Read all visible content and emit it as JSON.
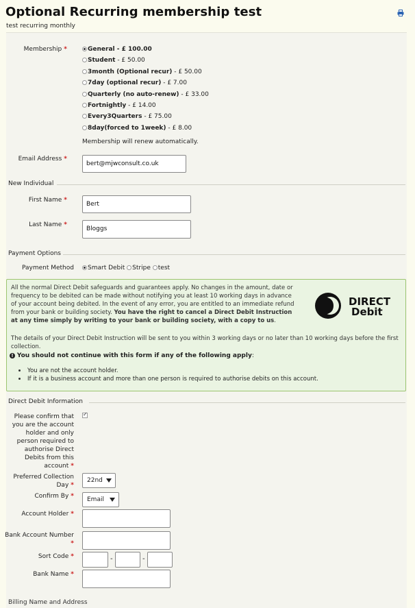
{
  "header": {
    "title": "Optional Recurring membership test",
    "subtitle": "test recurring monthly"
  },
  "membership": {
    "label": "Membership",
    "required": "*",
    "options": [
      {
        "name": "General",
        "price": " - £ 100.00"
      },
      {
        "name": "Student",
        "price": " - £ 50.00"
      },
      {
        "name": "3month (Optional recur)",
        "price": " - £ 50.00"
      },
      {
        "name": "7day (optional recur)",
        "price": " - £ 7.00"
      },
      {
        "name": "Quarterly (no auto-renew)",
        "price": " - £ 33.00"
      },
      {
        "name": "Fortnightly",
        "price": " - £ 14.00"
      },
      {
        "name": "Every3Quarters",
        "price": " - £ 75.00"
      },
      {
        "name": "8day(forced to 1week)",
        "price": " - £ 8.00"
      }
    ],
    "selected": "General",
    "renew_note": "Membership will renew automatically."
  },
  "email": {
    "label": "Email Address",
    "value": "bert@mjwconsult.co.uk"
  },
  "individual": {
    "legend": "New Individual",
    "first_name_label": "First Name",
    "first_name_value": "Bert",
    "last_name_label": "Last Name",
    "last_name_value": "Bloggs"
  },
  "payment": {
    "legend": "Payment Options",
    "method_label": "Payment Method",
    "methods": [
      "Smart Debit",
      "Stripe",
      "test"
    ],
    "selected": "Smart Debit"
  },
  "direct_debit_notice": {
    "para1_plain": "All the normal Direct Debit safeguards and guarantees apply. No changes in the amount, date or frequency to be debited can be made without notifying you at least 10 working days in advance of your account being debited. In the event of any error, you are entitled to an immediate refund from your bank or building society. ",
    "para1_bold": "You have the right to cancel a Direct Debit Instruction at any time simply by writing to your bank or building society, with a copy to us",
    "para1_end": ".",
    "para2": "The details of your Direct Debit Instruction will be sent to you within 3 working days or no later than 10 working days before the first collection.",
    "warning": "You should not continue with this form if any of the following apply",
    "warning_end": ":",
    "items": [
      "You are not the account holder.",
      "If it is a business account and more than one person is required to authorise debits on this account."
    ],
    "logo_line1": "DIRECT",
    "logo_line2": "Debit"
  },
  "dd_info": {
    "legend": "Direct Debit Information",
    "confirm_lines": [
      "Please confirm that",
      "you are the account",
      "holder and only",
      "person required to",
      "authorise Direct",
      "Debits from this",
      "account"
    ],
    "confirm_checked": true,
    "collection_day_lines": [
      "Preferred Collection",
      "Day"
    ],
    "collection_day_value": "22nd",
    "confirm_by_label": "Confirm By",
    "confirm_by_value": "Email",
    "account_holder_label": "Account Holder",
    "bank_account_lines": [
      "Bank Account Number"
    ],
    "sort_code_label": "Sort Code",
    "sort_code_sep": "-",
    "bank_name_label": "Bank Name",
    "next_legend": "Billing Name and Address"
  },
  "colors": {
    "background": "#fbfbee",
    "required": "#cc2222",
    "notice_bg": "#eaf4e2",
    "notice_border": "#9cc56f"
  },
  "icons": {
    "print": "print-icon",
    "warning": "exclamation-icon"
  }
}
